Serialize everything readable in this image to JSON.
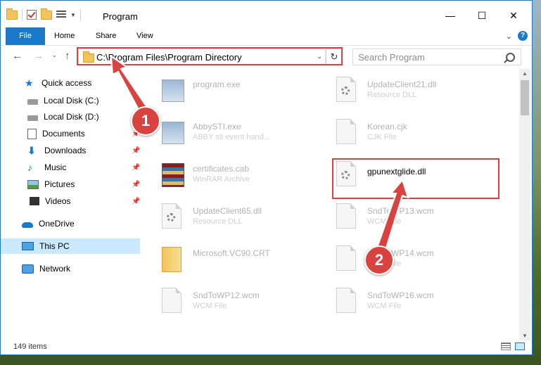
{
  "window": {
    "title": "Program",
    "controls": {
      "minimize": "—",
      "maximize": "☐",
      "close": "✕"
    }
  },
  "ribbon": {
    "tabs": [
      "File",
      "Home",
      "Share",
      "View"
    ]
  },
  "nav": {
    "address": "C:\\Program Files\\Program Directory",
    "search_placeholder": "Search Program"
  },
  "sidebar": {
    "items": [
      {
        "label": "Quick access",
        "icon": "star-icon",
        "pinned": false
      },
      {
        "label": "Local Disk (C:)",
        "icon": "disk-icon",
        "pinned": false
      },
      {
        "label": "Local Disk (D:)",
        "icon": "disk-icon",
        "pinned": false
      },
      {
        "label": "Documents",
        "icon": "document-icon",
        "pinned": true
      },
      {
        "label": "Downloads",
        "icon": "download-icon",
        "pinned": true
      },
      {
        "label": "Music",
        "icon": "music-icon",
        "pinned": true
      },
      {
        "label": "Pictures",
        "icon": "picture-icon",
        "pinned": true
      },
      {
        "label": "Videos",
        "icon": "video-icon",
        "pinned": true
      },
      {
        "label": "OneDrive",
        "icon": "cloud-icon",
        "pinned": false
      },
      {
        "label": "This PC",
        "icon": "computer-icon",
        "pinned": false,
        "selected": true
      },
      {
        "label": "Network",
        "icon": "network-icon",
        "pinned": false
      }
    ]
  },
  "files": [
    {
      "name": "program.exe",
      "type": "",
      "icon": "exe-icon"
    },
    {
      "name": "UpdateClient21.dll",
      "type": "Resource DLL",
      "icon": "dll-icon"
    },
    {
      "name": "AbbySTI.exe",
      "type": "ABBY sti event hand...",
      "icon": "exe-icon"
    },
    {
      "name": "Korean.cjk",
      "type": "CJK File",
      "icon": "file-icon"
    },
    {
      "name": "certificates.cab",
      "type": "WinRAR Archive",
      "icon": "rar-icon"
    },
    {
      "name": "gpunextglide.dll",
      "type": "",
      "icon": "dll-icon",
      "highlighted": true
    },
    {
      "name": "UpdateClient65.dll",
      "type": "Resource DLL",
      "icon": "dll-icon"
    },
    {
      "name": "SndToWP13.wcm",
      "type": "WCM File",
      "icon": "file-icon"
    },
    {
      "name": "Microsoft.VC90.CRT",
      "type": "",
      "icon": "folder-icon"
    },
    {
      "name": "SndToWP14.wcm",
      "type": "WCM File",
      "icon": "file-icon"
    },
    {
      "name": "SndToWP12.wcm",
      "type": "WCM File",
      "icon": "file-icon"
    },
    {
      "name": "SndToWP16.wcm",
      "type": "WCM File",
      "icon": "file-icon"
    }
  ],
  "status": {
    "item_count": "149 items"
  },
  "annotations": {
    "step1": "1",
    "step2": "2",
    "color": "#d9433f"
  },
  "colors": {
    "accent": "#1979ca",
    "selection": "#cce8ff"
  }
}
